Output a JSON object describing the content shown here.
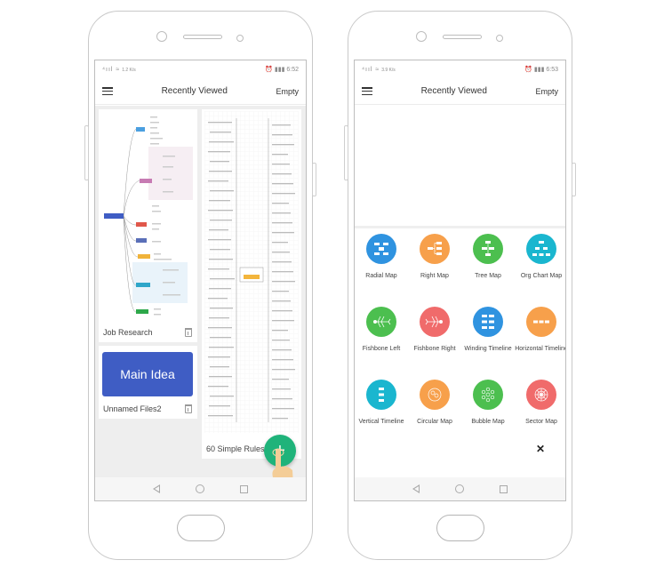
{
  "left_phone": {
    "status": {
      "signal": "⁴ııl ≈",
      "speed": "1.2 K/s",
      "time": "6:52"
    },
    "appbar": {
      "title": "Recently Viewed",
      "action": "Empty"
    },
    "files": [
      {
        "name": "Job Research",
        "preview": "mind-map"
      },
      {
        "name": "Unnamed Files2",
        "preview_text": "Main Idea"
      },
      {
        "name": "60 Simple Rules"
      }
    ],
    "fab_label": "+",
    "colors": {
      "fab": "#1fb37a",
      "main_idea": "#3f5dc4"
    }
  },
  "right_phone": {
    "status": {
      "signal": "⁴ııl ≈",
      "speed": "3.9 K/s",
      "time": "6:53"
    },
    "appbar": {
      "title": "Recently Viewed",
      "action": "Empty"
    },
    "templates": [
      {
        "label": "Radial Map",
        "color": "#2f93e0",
        "icon": "radial-map-icon"
      },
      {
        "label": "Right Map",
        "color": "#f7a04b",
        "icon": "right-map-icon"
      },
      {
        "label": "Tree Map",
        "color": "#4cbf4f",
        "icon": "tree-map-icon"
      },
      {
        "label": "Org Chart Map",
        "color": "#1ab6cf",
        "icon": "org-chart-icon"
      },
      {
        "label": "Fishbone Left",
        "color": "#4cbf4f",
        "icon": "fishbone-left-icon"
      },
      {
        "label": "Fishbone Right",
        "color": "#f06b6b",
        "icon": "fishbone-right-icon"
      },
      {
        "label": "Winding Timeline",
        "color": "#2f93e0",
        "icon": "winding-timeline-icon"
      },
      {
        "label": "Horizontal Timeline",
        "color": "#f7a04b",
        "icon": "horizontal-timeline-icon"
      },
      {
        "label": "Vertical Timeline",
        "color": "#1ab6cf",
        "icon": "vertical-timeline-icon"
      },
      {
        "label": "Circular Map",
        "color": "#f7a04b",
        "icon": "circular-map-icon"
      },
      {
        "label": "Bubble Map",
        "color": "#4cbf4f",
        "icon": "bubble-map-icon"
      },
      {
        "label": "Sector Map",
        "color": "#f06b6b",
        "icon": "sector-map-icon"
      }
    ],
    "close_label": "✕"
  }
}
